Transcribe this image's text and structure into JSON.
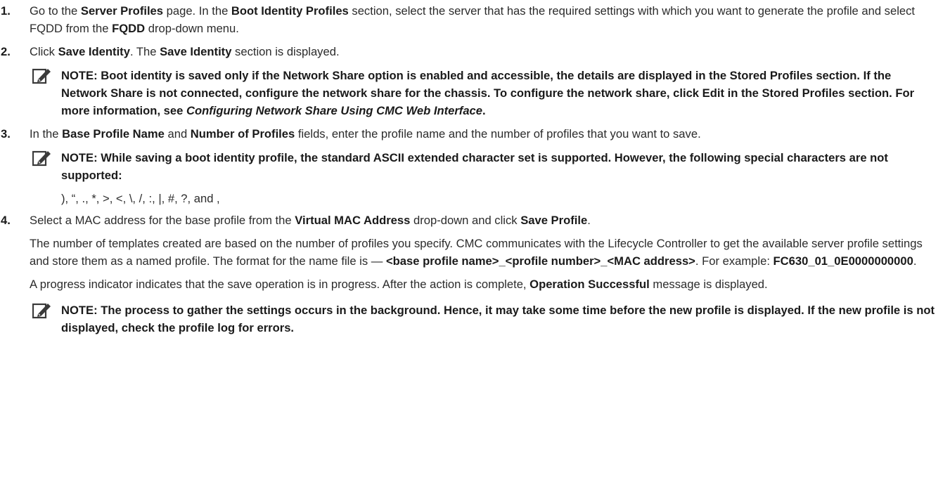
{
  "steps": [
    {
      "number": "1.",
      "parts": [
        {
          "t": "Go to the ",
          "b": false
        },
        {
          "t": "Server Profiles",
          "b": true
        },
        {
          "t": " page. In the ",
          "b": false
        },
        {
          "t": "Boot Identity Profiles",
          "b": true
        },
        {
          "t": " section, select the server that has the required settings with which you want to generate the profile and select FQDD from the ",
          "b": false
        },
        {
          "t": "FQDD",
          "b": true
        },
        {
          "t": " drop-down menu.",
          "b": false
        }
      ]
    },
    {
      "number": "2.",
      "parts": [
        {
          "t": "Click ",
          "b": false
        },
        {
          "t": "Save Identity",
          "b": true
        },
        {
          "t": ". The ",
          "b": false
        },
        {
          "t": "Save Identity",
          "b": true
        },
        {
          "t": " section is displayed.",
          "b": false
        }
      ]
    },
    {
      "number": "3.",
      "parts": [
        {
          "t": "In the ",
          "b": false
        },
        {
          "t": "Base Profile Name",
          "b": true
        },
        {
          "t": " and ",
          "b": false
        },
        {
          "t": "Number of Profiles",
          "b": true
        },
        {
          "t": " fields, enter the profile name and the number of profiles that you want to save.",
          "b": false
        }
      ]
    },
    {
      "number": "4.",
      "parts": [
        {
          "t": "Select a MAC address for the base profile from the ",
          "b": false
        },
        {
          "t": "Virtual MAC Address",
          "b": true
        },
        {
          "t": " drop-down and click ",
          "b": false
        },
        {
          "t": "Save Profile",
          "b": true
        },
        {
          "t": ".",
          "b": false
        }
      ]
    }
  ],
  "note1": {
    "parts": [
      {
        "t": "NOTE: Boot identity is saved only if the Network Share option is enabled and accessible, the details are displayed in the Stored Profiles section. If the Network Share is not connected, configure the network share for the chassis. To configure the network share, click Edit in the Stored Profiles section. For more information, see ",
        "i": false
      },
      {
        "t": "Configuring Network Share Using CMC Web Interface",
        "i": true
      },
      {
        "t": ".",
        "i": false
      }
    ]
  },
  "note2": {
    "text": "NOTE: While saving a boot identity profile, the standard ASCII extended character set is supported. However, the following special characters are not supported:"
  },
  "special_chars": "), “, ., *, >, <, \\, /, :, |, #, ?, and ,",
  "para_templates": {
    "parts": [
      {
        "t": "The number of templates created are based on the number of profiles you specify. CMC communicates with the Lifecycle Controller to get the available server profile settings and store them as a named profile. The format for the name file is — ",
        "b": false
      },
      {
        "t": "<base profile name>_<profile number>_<MAC address>",
        "b": true
      },
      {
        "t": ". For example: ",
        "b": false
      },
      {
        "t": "FC630_01_0E0000000000",
        "b": true
      },
      {
        "t": ".",
        "b": false
      }
    ]
  },
  "para_progress": {
    "parts": [
      {
        "t": "A progress indicator indicates that the save operation is in progress. After the action is complete, ",
        "b": false
      },
      {
        "t": "Operation Successful",
        "b": true
      },
      {
        "t": " message is displayed.",
        "b": false
      }
    ]
  },
  "note3": {
    "text": "NOTE: The process to gather the settings occurs in the background. Hence, it may take some time before the new profile is displayed. If the new profile is not displayed, check the profile log for errors."
  },
  "icon": "pencil-note-icon"
}
